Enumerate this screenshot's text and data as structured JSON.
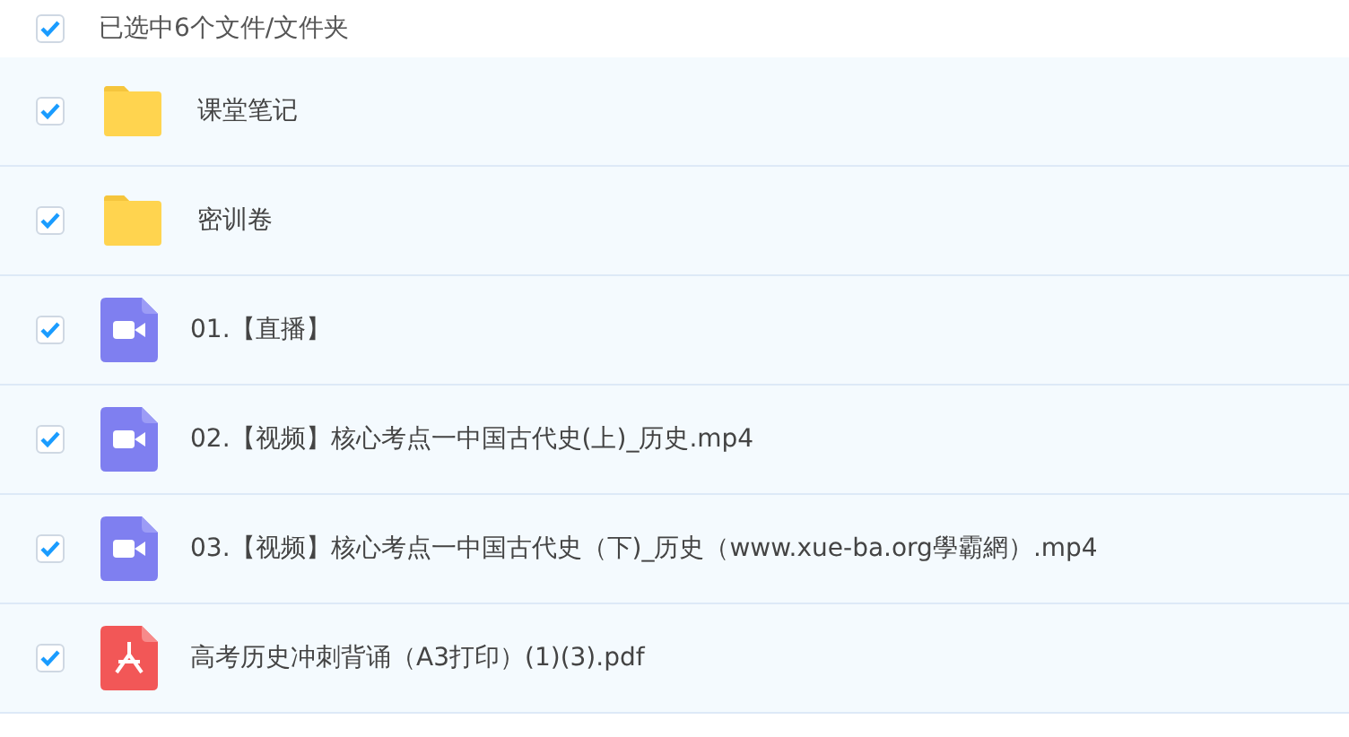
{
  "header": {
    "label": "已选中6个文件/文件夹",
    "checked": true
  },
  "files": [
    {
      "kind": "folder",
      "name": "课堂笔记",
      "checked": true
    },
    {
      "kind": "folder",
      "name": "密训卷",
      "checked": true
    },
    {
      "kind": "video",
      "name": "01.【直播】",
      "checked": true
    },
    {
      "kind": "video",
      "name": "02.【视频】核心考点一中国古代史(上)_历史.mp4",
      "checked": true
    },
    {
      "kind": "video",
      "name": "03.【视频】核心考点一中国古代史（下)_历史（www.xue-ba.org學霸網）.mp4",
      "checked": true
    },
    {
      "kind": "pdf",
      "name": "高考历史冲刺背诵（A3打印）(1)(3).pdf",
      "checked": true
    }
  ]
}
